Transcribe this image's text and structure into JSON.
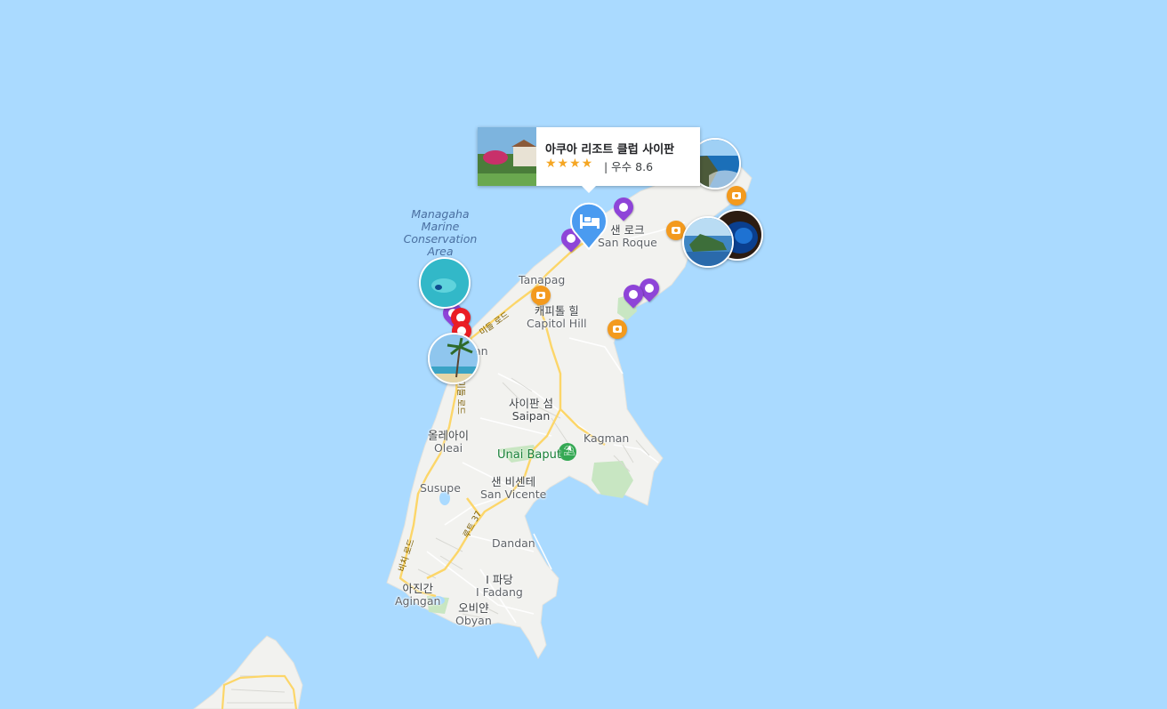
{
  "hotel_card": {
    "name": "아쿠아 리조트 클럽 사이판",
    "stars": "★★★★",
    "rating_text": "| 우수 8.6"
  },
  "marine_area": {
    "line1": "Managaha",
    "line2": "Marine",
    "line3": "Conservation",
    "line4": "Area"
  },
  "places": {
    "san_roque": {
      "ko": "샌 로크",
      "en": "San Roque"
    },
    "tanapag": {
      "en": "Tanapag"
    },
    "capitol_hill": {
      "ko": "캐피톨 힐",
      "en": "Capitol Hill"
    },
    "garapan_partial": {
      "en": "an"
    },
    "saipan": {
      "ko": "사이판 섬",
      "en": "Saipan"
    },
    "kagman": {
      "en": "Kagman"
    },
    "oleai": {
      "ko": "올레아이",
      "en": "Oleai"
    },
    "susupe": {
      "en": "Susupe"
    },
    "san_vicente": {
      "ko": "샌 비센테",
      "en": "San Vicente"
    },
    "dandan": {
      "en": "Dandan"
    },
    "i_fadang": {
      "ko": "I 파당",
      "en": "I Fadang"
    },
    "agingan": {
      "ko": "아진간",
      "en": "Agingan"
    },
    "obyan": {
      "ko": "오비얀",
      "en": "Obyan"
    }
  },
  "poi": {
    "unai_baput": "Unai Baput"
  },
  "roads": {
    "middle_road_1": "미들 로드",
    "middle_road_2": "미들 로드",
    "route_37": "루트 37",
    "beach_road": "비치 로드"
  },
  "colors": {
    "water": "#aadaff",
    "land": "#f2f2ef",
    "road_major": "#fcd669",
    "poi_purple": "#8e44d8",
    "poi_red": "#ea1d24",
    "camera_orange": "#f39a1e",
    "hotel_blue": "#4a9bf0",
    "park_green": "#c8e6c2"
  },
  "markers": {
    "hotel_icon": "bed-icon",
    "camera_icon": "camera-icon",
    "poi_icon": "place-pin-icon",
    "beach_icon": "beach-icon"
  }
}
